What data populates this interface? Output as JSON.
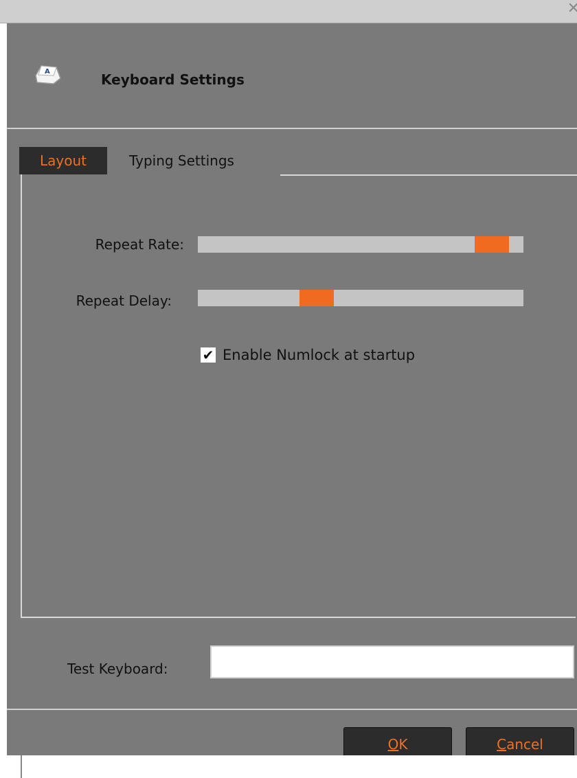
{
  "window": {
    "close_glyph": "✕"
  },
  "header": {
    "title": "Keyboard Settings",
    "icon": "keyboard-key-icon"
  },
  "tabs": [
    {
      "label": "Layout",
      "active": true
    },
    {
      "label": "Typing Settings",
      "active": false
    }
  ],
  "typing": {
    "repeat_rate": {
      "label": "Repeat Rate:",
      "value": 0.95
    },
    "repeat_delay": {
      "label": "Repeat Delay:",
      "value": 0.35
    },
    "numlock": {
      "label": "Enable Numlock at startup",
      "checked": true,
      "check_glyph": "✔"
    }
  },
  "test": {
    "label": "Test Keyboard:",
    "value": "",
    "placeholder": ""
  },
  "buttons": {
    "ok": {
      "label_mnemonic": "O",
      "label_rest": "K"
    },
    "cancel": {
      "label_mnemonic": "C",
      "label_rest": "ancel"
    }
  },
  "colors": {
    "accent": "#f06a1f",
    "background": "#7a7a7a",
    "button_bg": "#2c2c2c"
  }
}
